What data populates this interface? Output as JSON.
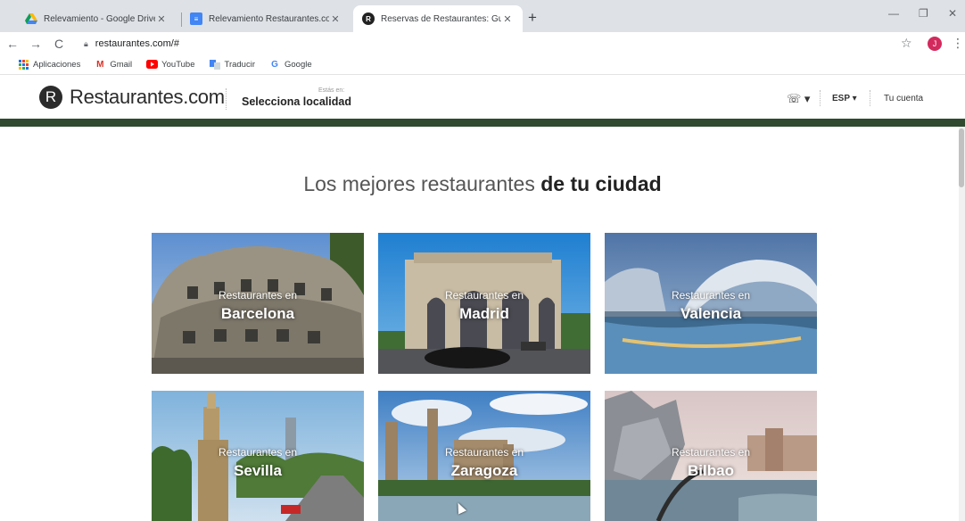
{
  "browser": {
    "tabs": [
      {
        "title": "Relevamiento - Google Drive",
        "icon": "google-drive-icon",
        "active": false
      },
      {
        "title": "Relevamiento Restaurantes.com",
        "icon": "google-docs-icon",
        "active": false
      },
      {
        "title": "Reservas de Restaurantes: Guía y",
        "icon": "restaurantes-r-icon",
        "active": true
      }
    ],
    "new_tab": "+",
    "url": "restaurantes.com/#",
    "profile_initial": "J",
    "bookmarks": [
      {
        "label": "Aplicaciones",
        "icon": "apps-grid-icon"
      },
      {
        "label": "Gmail",
        "icon": "gmail-icon"
      },
      {
        "label": "YouTube",
        "icon": "youtube-icon"
      },
      {
        "label": "Traducir",
        "icon": "translate-icon"
      },
      {
        "label": "Google",
        "icon": "google-icon"
      }
    ]
  },
  "site": {
    "logo_letter": "R",
    "logo_text": "Restaurantes.com",
    "location_small": "Estás en:",
    "location_label": "Selecciona localidad",
    "language": "ESP ▾",
    "account": "Tu cuenta",
    "colors": {
      "green_bar": "#2f4a2f"
    }
  },
  "main": {
    "headline_light": "Los mejores restaurantes",
    "headline_bold": "de tu ciudad",
    "cities": [
      {
        "prefix": "Restaurantes en",
        "name": "Barcelona"
      },
      {
        "prefix": "Restaurantes en",
        "name": "Madrid"
      },
      {
        "prefix": "Restaurantes en",
        "name": "Valencia"
      },
      {
        "prefix": "Restaurantes en",
        "name": "Sevilla"
      },
      {
        "prefix": "Restaurantes en",
        "name": "Zaragoza"
      },
      {
        "prefix": "Restaurantes en",
        "name": "Bilbao"
      }
    ]
  }
}
